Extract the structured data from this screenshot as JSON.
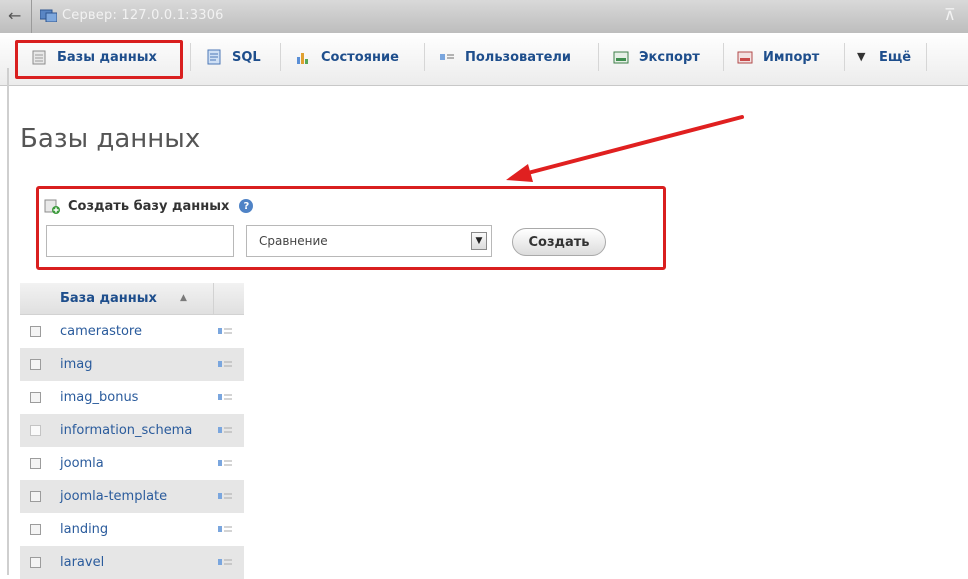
{
  "titlebar": {
    "server_label": "Сервер: 127.0.0.1:3306"
  },
  "tabs": [
    {
      "label": "Базы данных",
      "icon": "database-icon"
    },
    {
      "label": "SQL",
      "icon": "sql-icon"
    },
    {
      "label": "Состояние",
      "icon": "status-icon"
    },
    {
      "label": "Пользователи",
      "icon": "users-icon"
    },
    {
      "label": "Экспорт",
      "icon": "export-icon"
    },
    {
      "label": "Импорт",
      "icon": "import-icon"
    },
    {
      "label": "Ещё",
      "icon": "chevron-down-icon"
    }
  ],
  "page": {
    "title": "Базы данных"
  },
  "create_db": {
    "heading": "Создать базу данных",
    "name_value": "",
    "collation_value": "Сравнение",
    "button_label": "Создать"
  },
  "db_table": {
    "header": "База данных",
    "rows": [
      {
        "name": "camerastore"
      },
      {
        "name": "imag"
      },
      {
        "name": "imag_bonus"
      },
      {
        "name": "information_schema"
      },
      {
        "name": "joomla"
      },
      {
        "name": "joomla-template"
      },
      {
        "name": "landing"
      },
      {
        "name": "laravel"
      }
    ]
  },
  "colors": {
    "highlight_red": "#d91f1f",
    "link_blue": "#1e4e8c",
    "row_alt": "#e6e6e6"
  }
}
